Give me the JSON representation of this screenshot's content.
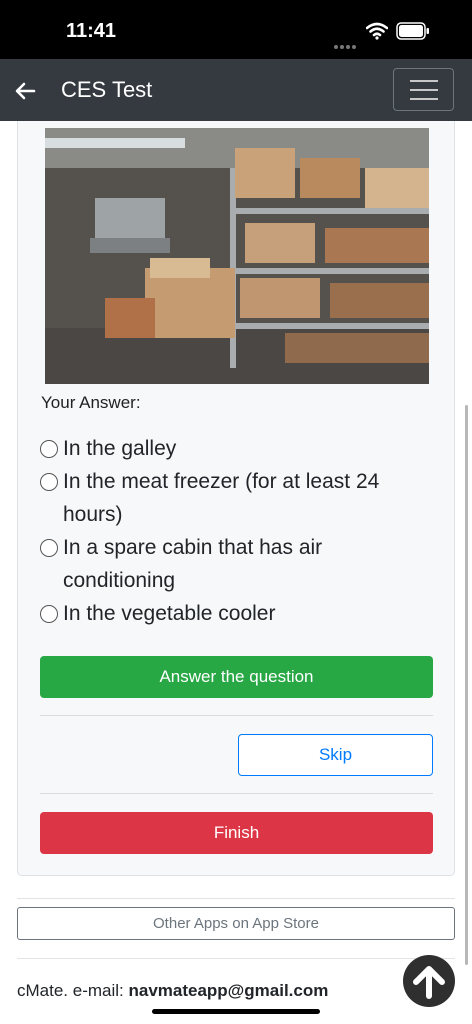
{
  "status_bar": {
    "time": "11:41"
  },
  "navbar": {
    "title": "CES Test",
    "back_icon": "arrow-left-icon",
    "menu_icon": "hamburger-icon"
  },
  "question": {
    "image_alt": "Provisions store room with metal shelves",
    "answer_label": "Your Answer:",
    "options": [
      {
        "label": "In the galley",
        "selected": false
      },
      {
        "label": "In the meat freezer (for at least 24 hours)",
        "selected": false
      },
      {
        "label": "In a spare cabin that has air conditioning",
        "selected": false
      },
      {
        "label": "In the vegetable cooler",
        "selected": false
      }
    ]
  },
  "buttons": {
    "answer": "Answer the question",
    "skip": "Skip",
    "finish": "Finish"
  },
  "footer": {
    "other_apps": "Other Apps on App Store",
    "contact_prefix": "cMate. e-mail:",
    "email": "navmateapp@gmail.com"
  },
  "colors": {
    "navbar": "#343a40",
    "success": "#28a745",
    "danger": "#dc3545",
    "primary": "#007bff"
  }
}
